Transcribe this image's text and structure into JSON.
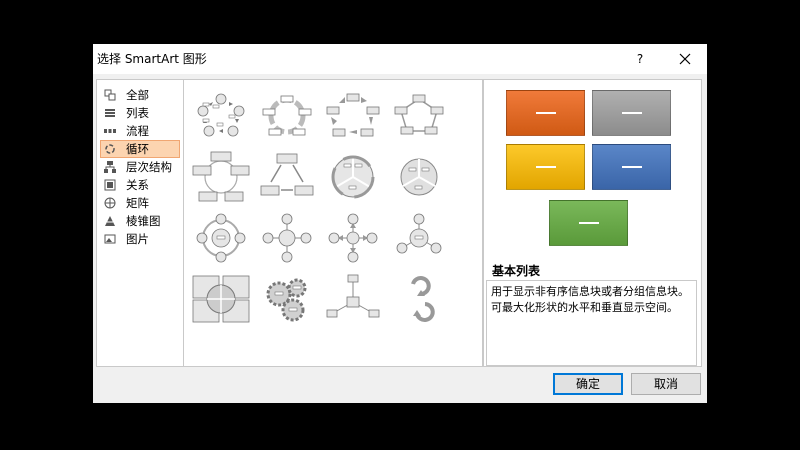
{
  "dialog": {
    "title": "选择 SmartArt 图形",
    "help_label": "?",
    "close_icon": "close-icon"
  },
  "categories": [
    {
      "label": "全部",
      "icon": "all-icon"
    },
    {
      "label": "列表",
      "icon": "list-icon"
    },
    {
      "label": "流程",
      "icon": "process-icon"
    },
    {
      "label": "循环",
      "icon": "cycle-icon",
      "selected": true
    },
    {
      "label": "层次结构",
      "icon": "hierarchy-icon"
    },
    {
      "label": "关系",
      "icon": "relationship-icon"
    },
    {
      "label": "矩阵",
      "icon": "matrix-icon"
    },
    {
      "label": "棱锥图",
      "icon": "pyramid-icon"
    },
    {
      "label": "图片",
      "icon": "picture-icon"
    }
  ],
  "gallery": {
    "thumbnails": [
      "basic-cycle-thumbnail",
      "continuous-cycle-thumbnail",
      "block-cycle-thumbnail",
      "nondirectional-cycle-thumbnail",
      "text-cycle-thumbnail",
      "multidirectional-cycle-thumbnail",
      "segmented-cycle-thumbnail",
      "basic-pie-thumbnail",
      "radial-cycle-thumbnail",
      "basic-radial-thumbnail",
      "diverging-radial-thumbnail",
      "radial-cluster-thumbnail",
      "cycle-matrix-thumbnail",
      "gear-thumbnail",
      "converging-radial-thumbnail",
      "arrow-ribbon-thumbnail"
    ]
  },
  "preview": {
    "colors": [
      "#e8701a",
      "#9c9c9c",
      "#f2b700",
      "#4472c4",
      "#6aa84f"
    ],
    "layout_name": "基本列表",
    "description": "用于显示非有序信息块或者分组信息块。可最大化形状的水平和垂直显示空间。"
  },
  "buttons": {
    "ok_label": "确定",
    "cancel_label": "取消"
  }
}
